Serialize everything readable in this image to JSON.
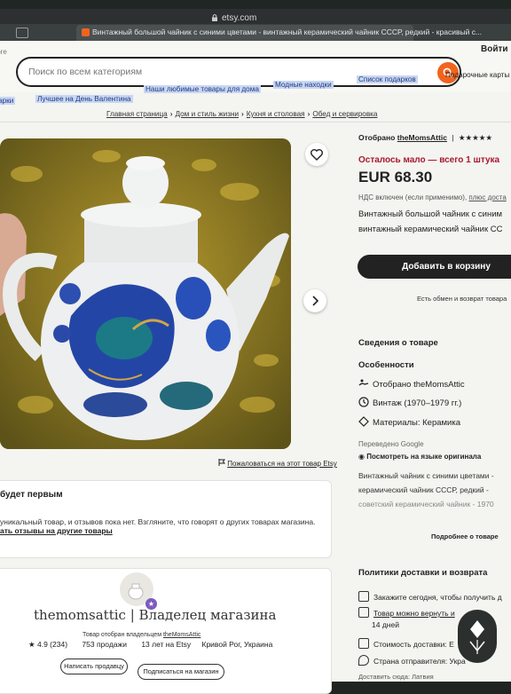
{
  "browser": {
    "address": "etsy.com",
    "tab_title": "Винтажный большой чайник с синими цветами - винтажный керамический чайник СССР, редкий - красивый с..."
  },
  "header": {
    "store_label": "tore",
    "search_placeholder": "Поиск по всем категориям",
    "sign_in": "Войти",
    "nav": [
      "арки",
      "Лучшее на День Валентина",
      "Наши любимые товары для дома",
      "Модные находки",
      "Список подарков",
      "Подарочные карты"
    ]
  },
  "breadcrumbs": [
    "Главная страница",
    "Дом и стиль жизни",
    "Кухня и столовая",
    "Обед и сервировка"
  ],
  "listing": {
    "report": "Пожаловаться на этот товар Etsy",
    "seller_prefix": "Отобрано",
    "seller_name": "theMomsAttic",
    "rating_stars": "★★★★★",
    "stock": "Осталось мало — всего 1 штука",
    "price": "EUR 68.30",
    "vat": "НДС включен (если применимо),",
    "vat_link": "плюс доста",
    "title_line1": "Винтажный большой чайник с синим",
    "title_line2": "винтажный керамический чайник СС",
    "add_to_cart": "Добавить в корзину",
    "exchange": "Есть обмен и возврат товара"
  },
  "details": {
    "title": "Сведения о товаре",
    "features_title": "Особенности",
    "features": [
      "Отобрано theMomsAttic",
      "Винтаж (1970–1979 гг.)",
      "Материалы: Керамика"
    ],
    "translated": "Переведено Google",
    "see_original": "Посмотреть на языке оригинала",
    "desc_lines": [
      "Винтажный чайник с синими цветами -",
      "керамический чайник СССР, редкий -",
      "советский керамический чайник - 1970"
    ],
    "more": "Подробнее о товаре"
  },
  "shipping": {
    "title": "Политики доставки и возврата",
    "items": [
      "Закажите сегодня, чтобы получить д",
      "Товар можно вернуть и",
      "14 дней",
      "Стоимость доставки: E",
      "Страна отправителя: Укра",
      "Доставить сюда: Латвия"
    ]
  },
  "reviews": {
    "title": "будет первым",
    "text": "уникальный товар, и отзывов пока нет. Взгляните, что говорят о других товарах магазина.",
    "link": "ать отзывы на другие товары"
  },
  "shop": {
    "name": "themomsattic | Владелец магазина",
    "sub_prefix": "Товар отобран владельцем",
    "sub_name": "theMomsAttic",
    "rating": "4.9 (234)",
    "sales": "753 продажи",
    "years": "13 лет на Etsy",
    "location": "Кривой Рог, Украина",
    "contact": "Написать продавцу",
    "follow": "Подписаться на магазин"
  },
  "colors": {
    "accent": "#f1641e",
    "stock_red": "#a61a2e",
    "cart_bg": "#222222",
    "nav_highlight": "#c9d7f0"
  }
}
